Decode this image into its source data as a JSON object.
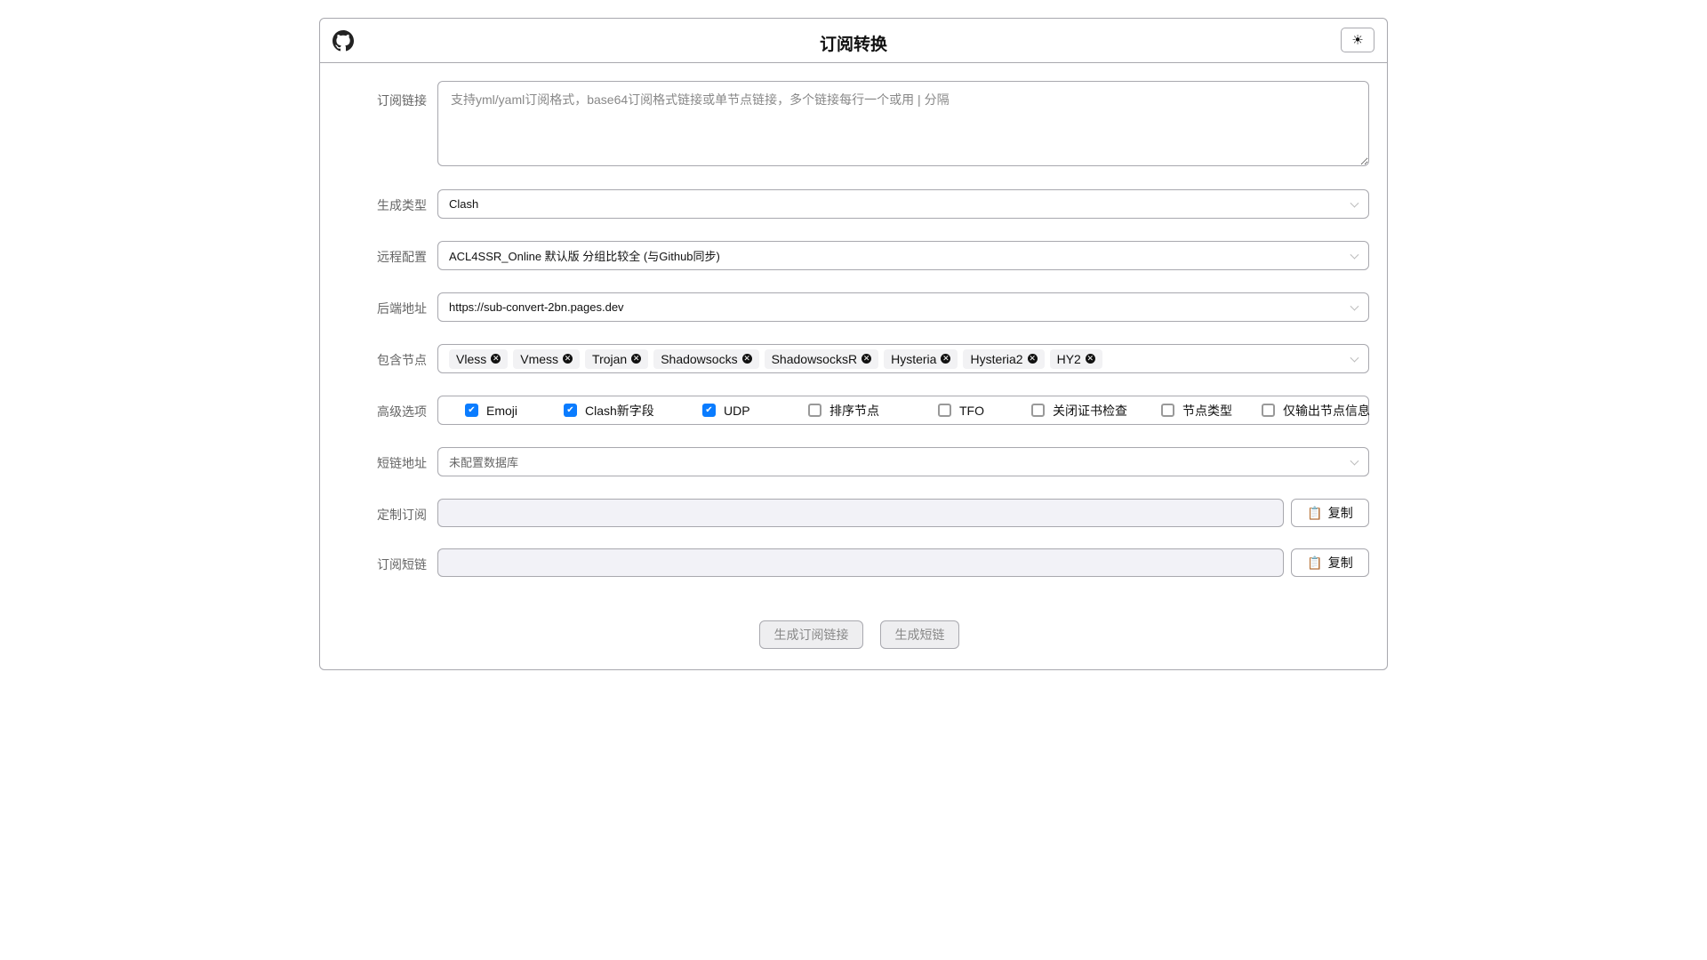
{
  "header": {
    "title": "订阅转换",
    "theme_icon": "sun-icon",
    "github_icon": "github-icon"
  },
  "form": {
    "subscription": {
      "label": "订阅链接",
      "placeholder": "支持yml/yaml订阅格式，base64订阅格式链接或单节点链接，多个链接每行一个或用 | 分隔"
    },
    "target": {
      "label": "生成类型",
      "value": "Clash"
    },
    "remote_config": {
      "label": "远程配置",
      "value": "ACL4SSR_Online 默认版 分组比较全 (与Github同步)"
    },
    "backend": {
      "label": "后端地址",
      "value": "https://sub-convert-2bn.pages.dev"
    },
    "nodes": {
      "label": "包含节点",
      "tags": [
        "Vless",
        "Vmess",
        "Trojan",
        "Shadowsocks",
        "ShadowsocksR",
        "Hysteria",
        "Hysteria2",
        "HY2"
      ]
    },
    "advanced": {
      "label": "高级选项",
      "options": [
        {
          "label": "Emoji",
          "checked": true
        },
        {
          "label": "Clash新字段",
          "checked": true
        },
        {
          "label": "UDP",
          "checked": true
        },
        {
          "label": "排序节点",
          "checked": false
        },
        {
          "label": "TFO",
          "checked": false
        },
        {
          "label": "关闭证书检查",
          "checked": false
        },
        {
          "label": "节点类型",
          "checked": false
        },
        {
          "label": "仅输出节点信息",
          "checked": false
        }
      ]
    },
    "short_url": {
      "label": "短链地址",
      "value": "未配置数据库"
    },
    "custom_sub": {
      "label": "定制订阅",
      "value": "",
      "copy_label": "复制"
    },
    "short_link": {
      "label": "订阅短链",
      "value": "",
      "copy_label": "复制"
    }
  },
  "actions": {
    "generate": "生成订阅链接",
    "shorten": "生成短链"
  },
  "colors": {
    "accent": "#0a7cff",
    "border": "#a8a8ae"
  }
}
